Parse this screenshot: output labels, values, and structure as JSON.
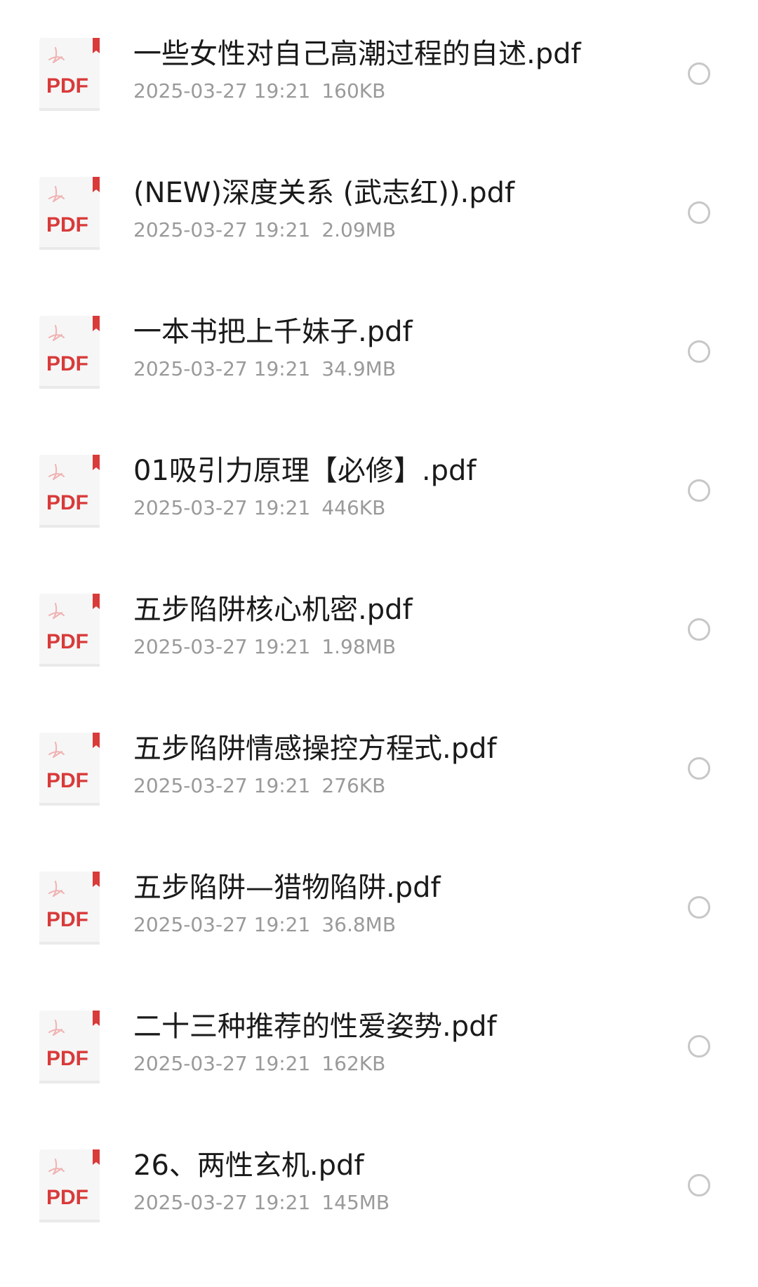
{
  "icon": {
    "name": "pdf-file-icon",
    "label": "PDF",
    "accent": "#d93a3a",
    "paper": "#f6f6f6"
  },
  "colors": {
    "name_text": "#1a1a1a",
    "meta_text": "#9a9a9a",
    "radio_border": "#c7c7c7"
  },
  "files": [
    {
      "name": "一些女性对自己高潮过程的自述.pdf",
      "date": "2025-03-27 19:21",
      "size": "160KB",
      "selected": false
    },
    {
      "name": "(NEW)深度关系 (武志红)).pdf",
      "date": "2025-03-27 19:21",
      "size": "2.09MB",
      "selected": false
    },
    {
      "name": "一本书把上千妹子.pdf",
      "date": "2025-03-27 19:21",
      "size": "34.9MB",
      "selected": false
    },
    {
      "name": "01吸引力原理【必修】.pdf",
      "date": "2025-03-27 19:21",
      "size": "446KB",
      "selected": false
    },
    {
      "name": "五步陷阱核心机密.pdf",
      "date": "2025-03-27 19:21",
      "size": "1.98MB",
      "selected": false
    },
    {
      "name": "五步陷阱情感操控方程式.pdf",
      "date": "2025-03-27 19:21",
      "size": "276KB",
      "selected": false
    },
    {
      "name": "五步陷阱—猎物陷阱.pdf",
      "date": "2025-03-27 19:21",
      "size": "36.8MB",
      "selected": false
    },
    {
      "name": "二十三种推荐的性爱姿势.pdf",
      "date": "2025-03-27 19:21",
      "size": "162KB",
      "selected": false
    },
    {
      "name": "26、两性玄机.pdf",
      "date": "2025-03-27 19:21",
      "size": "145MB",
      "selected": false
    }
  ]
}
